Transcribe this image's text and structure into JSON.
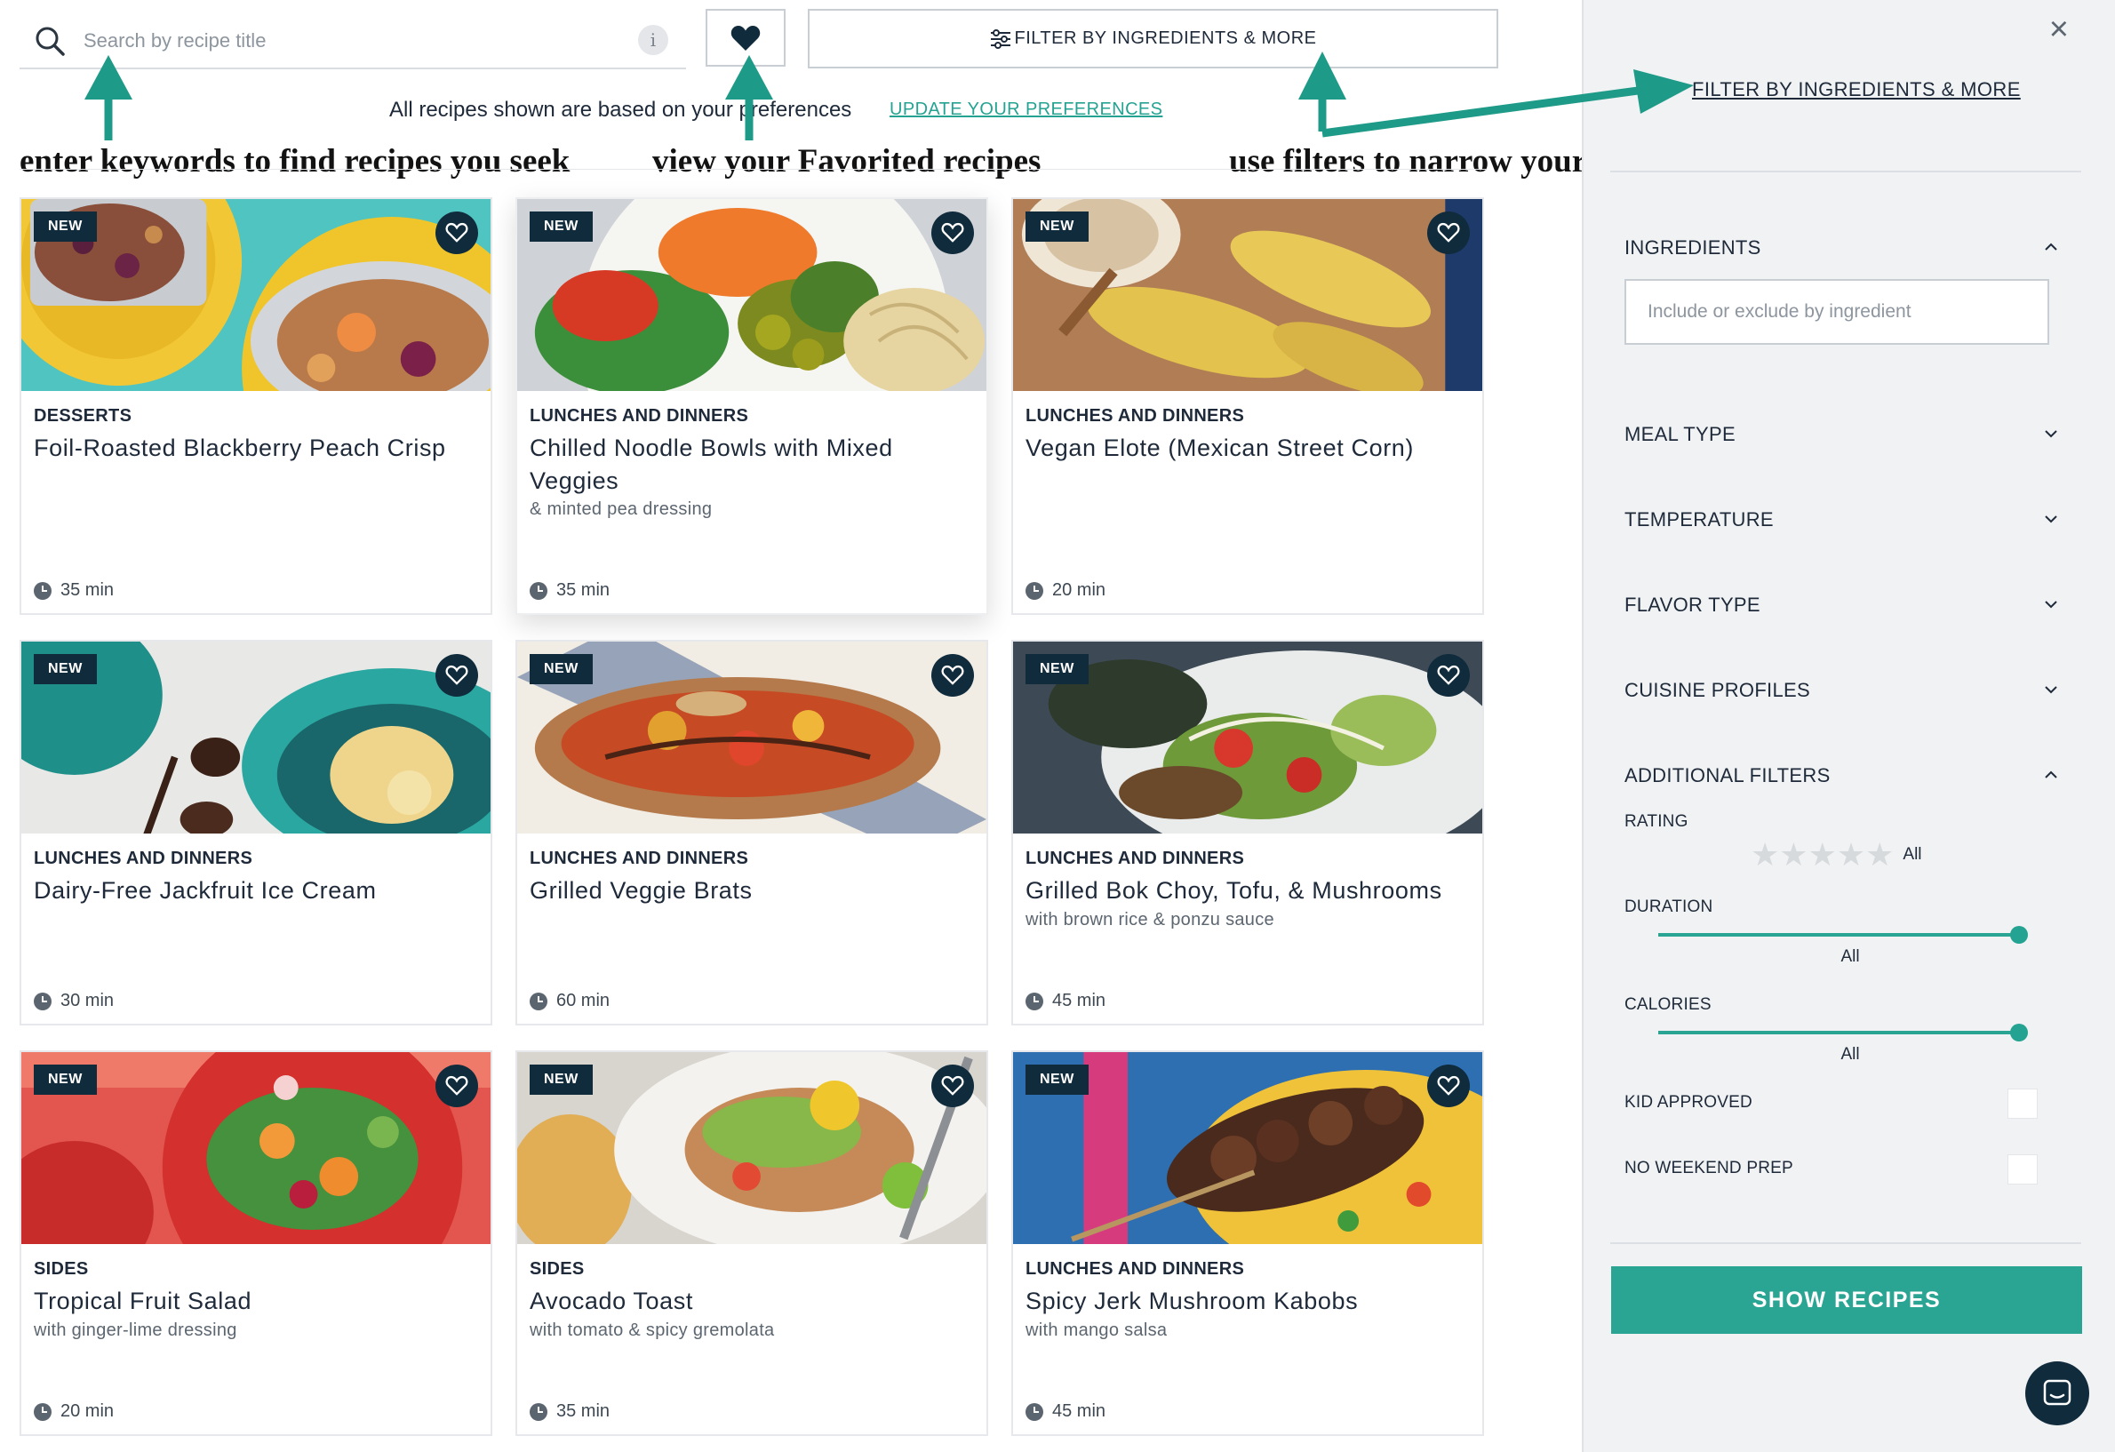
{
  "search": {
    "placeholder": "Search by recipe title",
    "info_label": "i"
  },
  "filter_button": {
    "label": "FILTER BY INGREDIENTS & MORE"
  },
  "preferences": {
    "text": "All recipes shown are based on your preferences",
    "link": "UPDATE YOUR PREFERENCES"
  },
  "annotations": {
    "search": "enter keywords to find recipes you seek",
    "favorites": "view your Favorited recipes",
    "filters": "use filters to narrow your recipe options"
  },
  "colors": {
    "accent": "#2aa594",
    "navy": "#0f2b3c",
    "sidebar_bg": "#f1f2f3"
  },
  "cards": [
    {
      "badge": "NEW",
      "category": "DESSERTS",
      "title": "Foil-Roasted Blackberry Peach Crisp",
      "subtitle": "",
      "time": "35 min"
    },
    {
      "badge": "NEW",
      "category": "LUNCHES AND DINNERS",
      "title": "Chilled Noodle Bowls with Mixed Veggies",
      "subtitle": "& minted pea dressing",
      "time": "35 min"
    },
    {
      "badge": "NEW",
      "category": "LUNCHES AND DINNERS",
      "title": "Vegan Elote (Mexican Street Corn)",
      "subtitle": "",
      "time": "20 min"
    },
    {
      "badge": "NEW",
      "category": "LUNCHES AND DINNERS",
      "title": "Dairy-Free Jackfruit Ice Cream",
      "subtitle": "",
      "time": "30 min"
    },
    {
      "badge": "NEW",
      "category": "LUNCHES AND DINNERS",
      "title": "Grilled Veggie Brats",
      "subtitle": "",
      "time": "60 min"
    },
    {
      "badge": "NEW",
      "category": "LUNCHES AND DINNERS",
      "title": "Grilled Bok Choy, Tofu, & Mushrooms",
      "subtitle": "with brown rice & ponzu sauce",
      "time": "45 min"
    },
    {
      "badge": "NEW",
      "category": "SIDES",
      "title": "Tropical Fruit Salad",
      "subtitle": "with ginger-lime dressing",
      "time": "20 min"
    },
    {
      "badge": "NEW",
      "category": "SIDES",
      "title": "Avocado Toast",
      "subtitle": "with tomato & spicy gremolata",
      "time": "35 min"
    },
    {
      "badge": "NEW",
      "category": "LUNCHES AND DINNERS",
      "title": "Spicy Jerk Mushroom Kabobs",
      "subtitle": "with mango salsa",
      "time": "45 min"
    }
  ],
  "sidebar": {
    "close": "×",
    "title": "FILTER BY INGREDIENTS & MORE",
    "ingredients": {
      "label": "INGREDIENTS",
      "placeholder": "Include or exclude by ingredient"
    },
    "sections": [
      "MEAL TYPE",
      "TEMPERATURE",
      "FLAVOR TYPE",
      "CUISINE PROFILES"
    ],
    "additional": {
      "label": "ADDITIONAL FILTERS",
      "rating_label": "RATING",
      "rating_value": "All",
      "duration_label": "DURATION",
      "duration_value": "All",
      "calories_label": "CALORIES",
      "calories_value": "All",
      "kid_approved": "KID APPROVED",
      "no_weekend_prep": "NO WEEKEND PREP"
    },
    "show_button": "SHOW RECIPES"
  }
}
